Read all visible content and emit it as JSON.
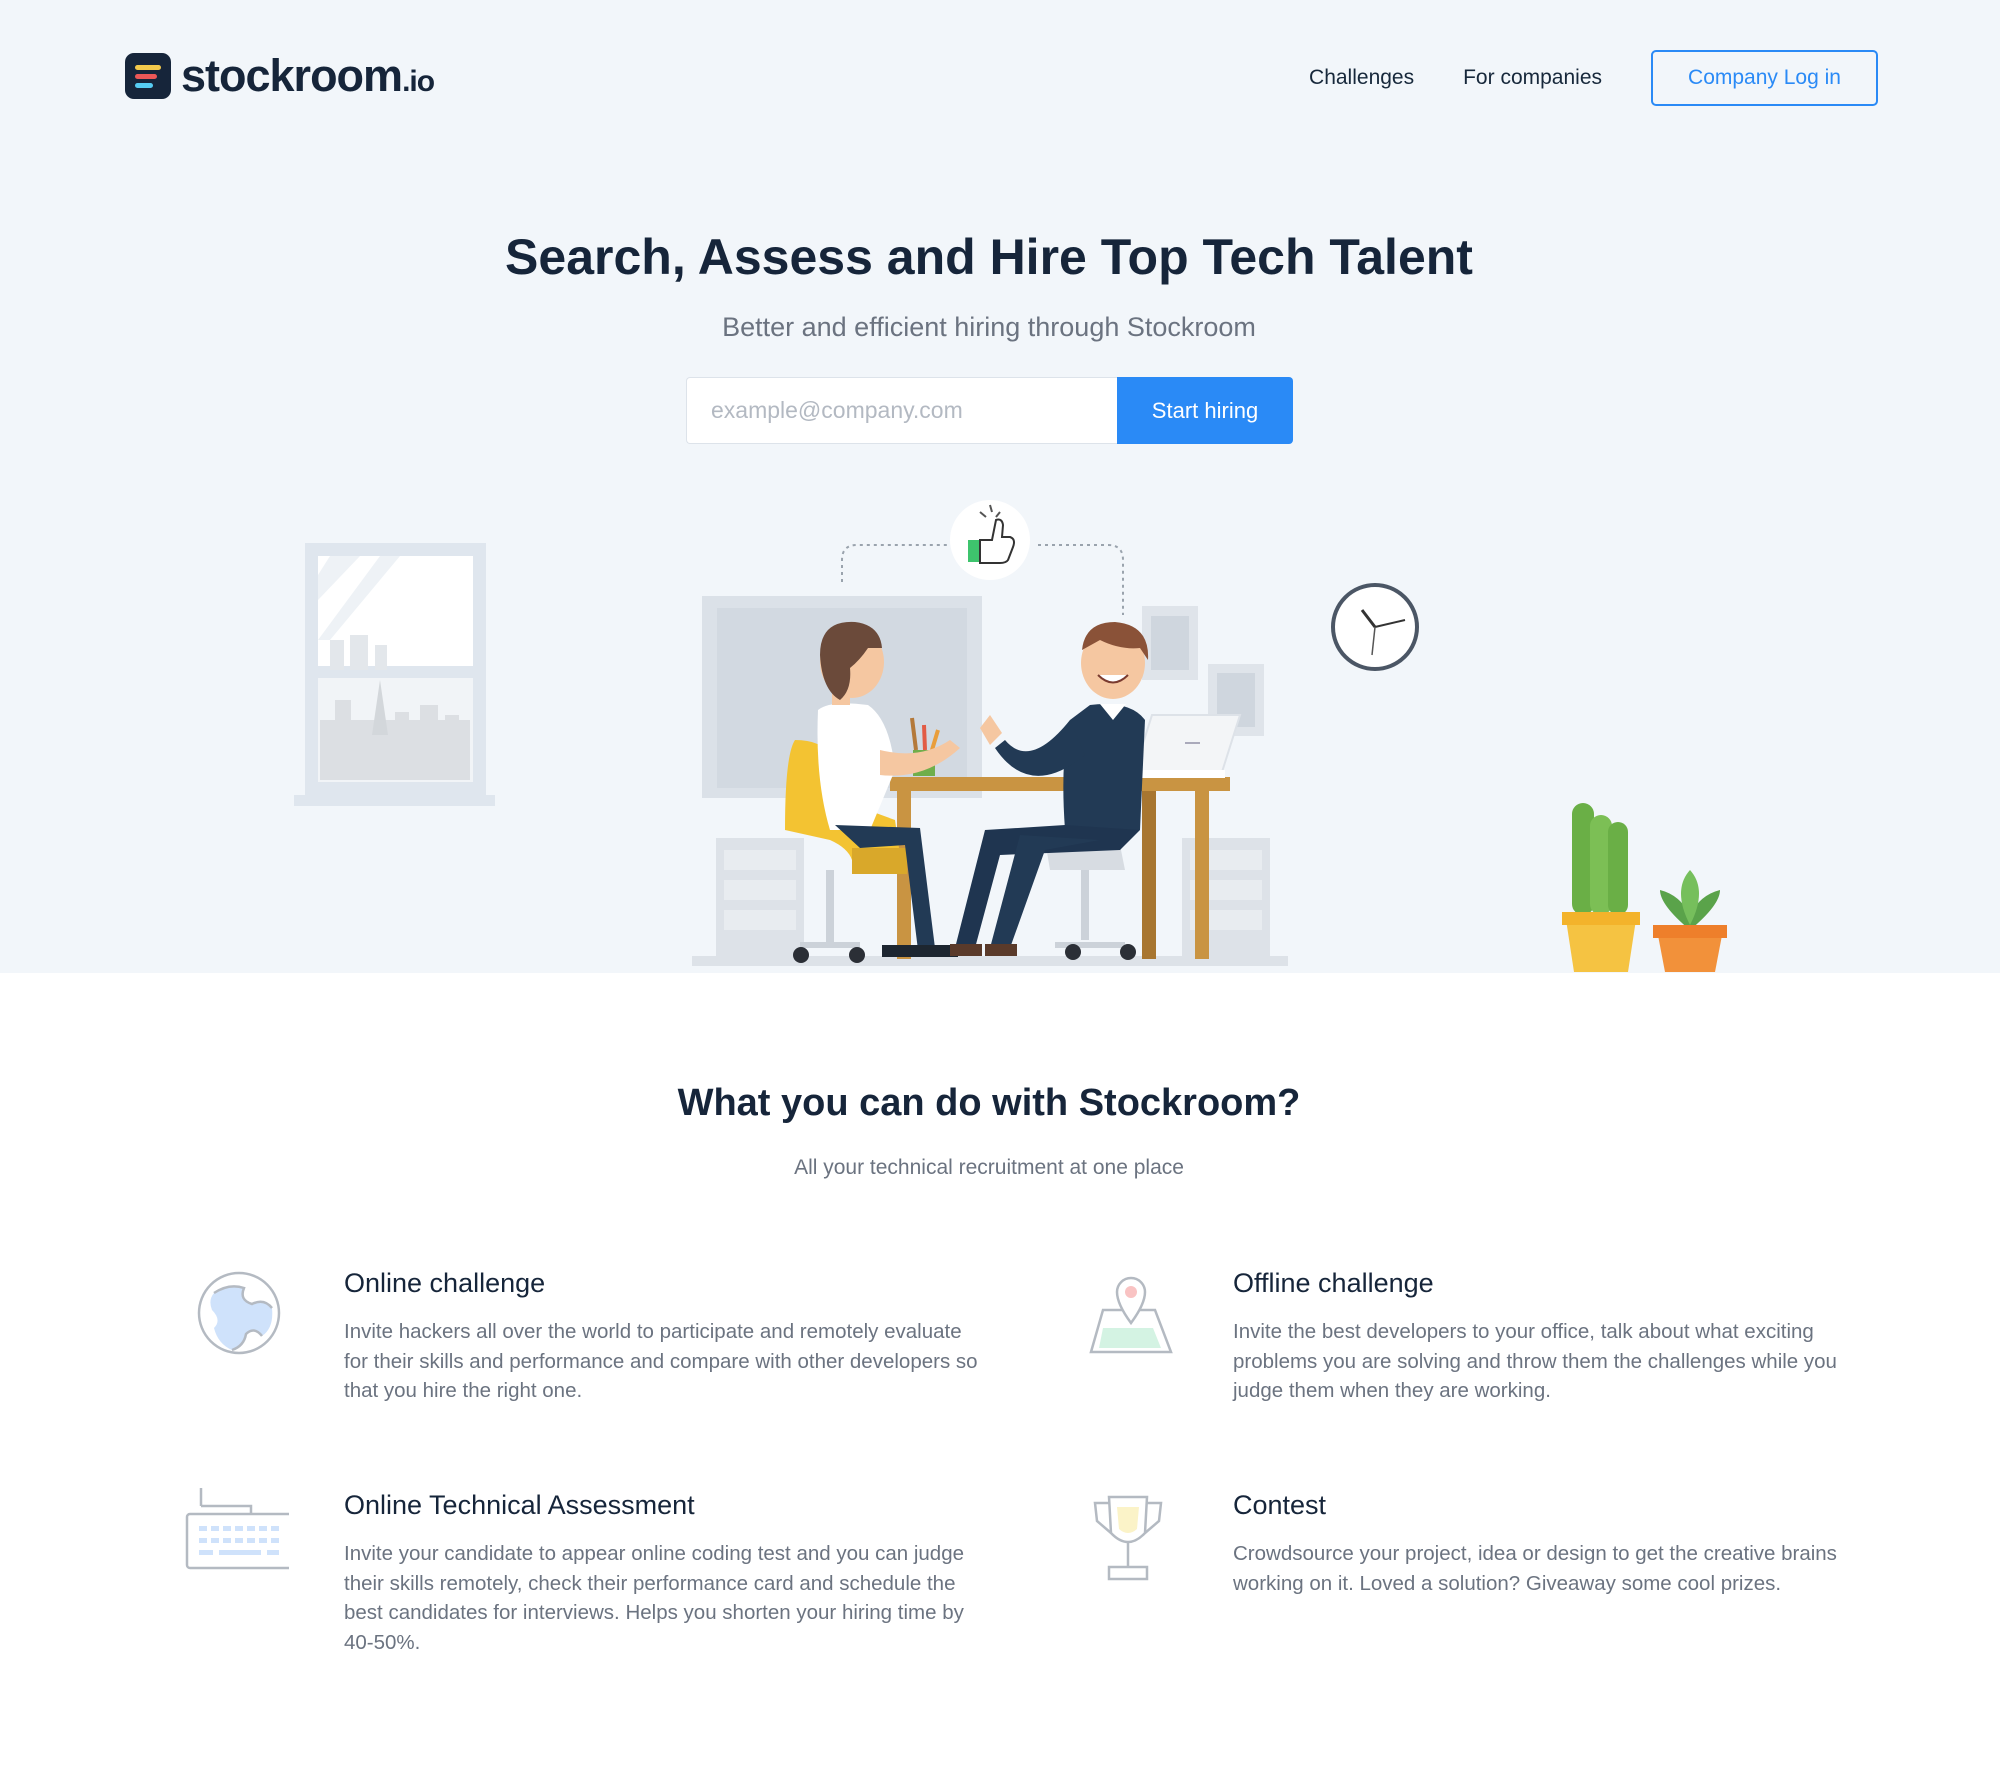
{
  "header": {
    "logo_text": "stockroom",
    "logo_suffix": ".io",
    "nav": {
      "challenges": "Challenges",
      "for_companies": "For companies",
      "login": "Company Log in"
    }
  },
  "hero": {
    "title": "Search, Assess and Hire Top Tech Talent",
    "subtitle": "Better and efficient hiring through Stockroom",
    "email_placeholder": "example@company.com",
    "cta": "Start hiring"
  },
  "features": {
    "title": "What you can do with Stockroom?",
    "subtitle": "All your technical recruitment at one place",
    "items": [
      {
        "icon": "globe-icon",
        "title": "Online challenge",
        "text": "Invite hackers all over the world to participate and remotely evaluate for their skills and performance and compare with other developers so that you hire the right one."
      },
      {
        "icon": "map-pin-icon",
        "title": "Offline challenge",
        "text": "Invite the best developers to your office, talk about what exciting problems you are solving and throw them the challenges while you judge them when they are working."
      },
      {
        "icon": "keyboard-icon",
        "title": "Online Technical Assessment",
        "text": "Invite your candidate to appear online coding test and you can judge their skills remotely, check their performance card and schedule the best candidates for interviews. Helps you shorten your hiring time by 40-50%."
      },
      {
        "icon": "trophy-icon",
        "title": "Contest",
        "text": "Crowdsource your project, idea or design to get the creative brains working on it. Loved a solution? Giveaway some cool prizes."
      }
    ]
  },
  "colors": {
    "accent": "#2a8af6",
    "navy": "#16253a",
    "hero_bg": "#f2f6fa",
    "muted_text": "#6b7380"
  }
}
